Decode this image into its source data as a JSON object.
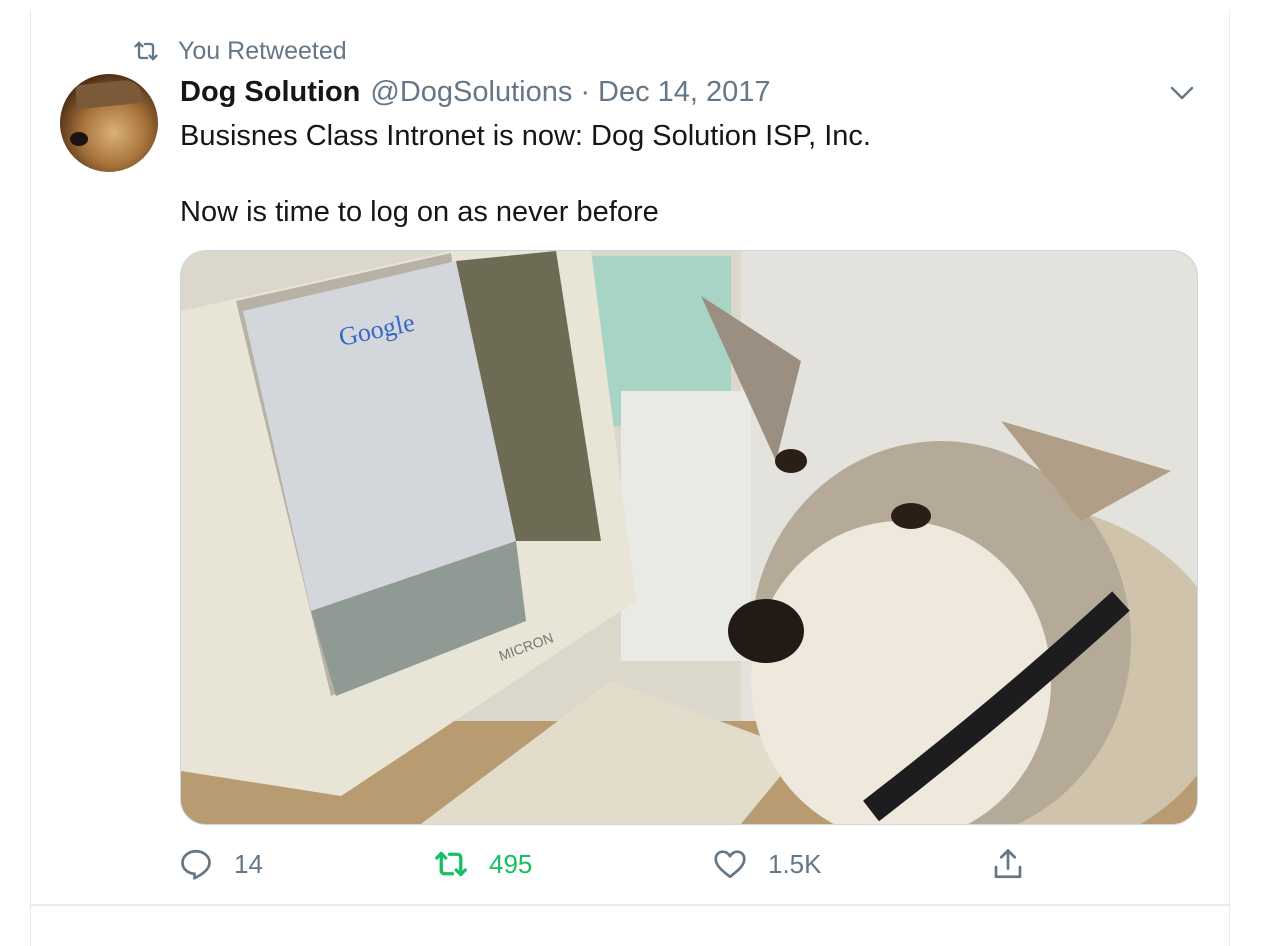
{
  "retweet_context": {
    "label": "You Retweeted",
    "icon": "retweet-icon"
  },
  "tweet": {
    "author_name": "Dog Solution",
    "handle": "@DogSolutions",
    "separator": "·",
    "date": "Dec 14, 2017",
    "text_line1": "Busisnes Class Intronet is now: Dog Solution ISP, Inc.",
    "text_line2": "Now is time to log on as never before",
    "media": {
      "screen_logo": "Google",
      "monitor_brand": "MICRON"
    }
  },
  "actions": {
    "reply_count": "14",
    "retweet_count": "495",
    "like_count": "1.5K",
    "retweeted": true
  },
  "colors": {
    "muted": "#657786",
    "retweet_green": "#17bf63",
    "border": "#e6ecf0",
    "text": "#14171a"
  }
}
